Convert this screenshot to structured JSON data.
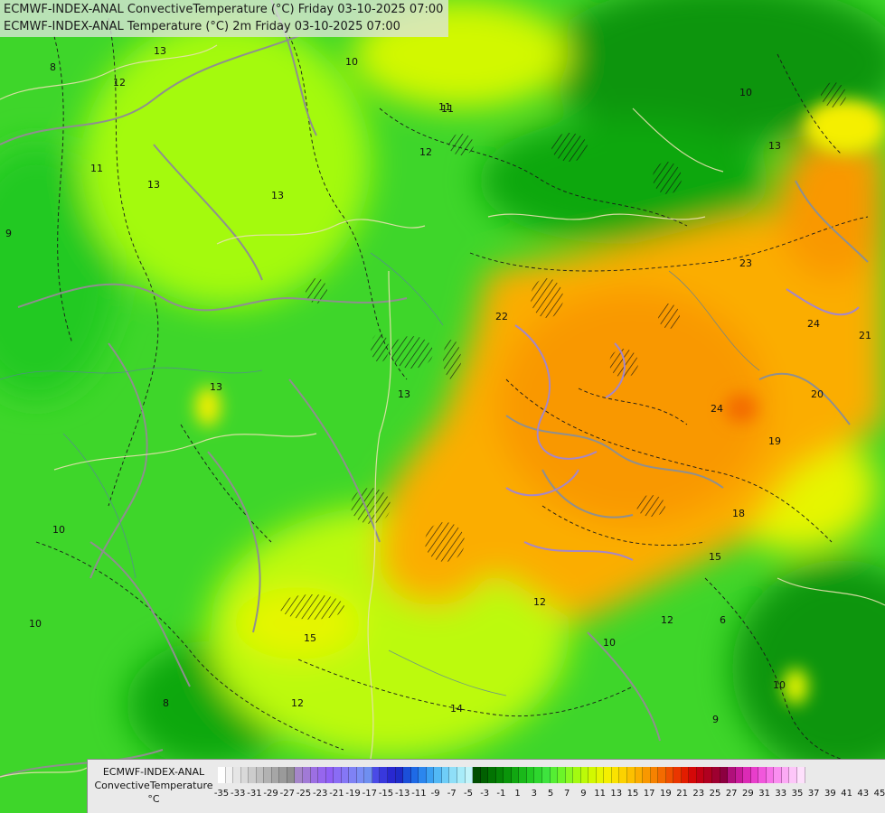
{
  "titles": {
    "line1": "ECMWF-INDEX-ANAL ConvectiveTemperature (°C) Friday 03-10-2025 07:00",
    "line2": "ECMWF-INDEX-ANAL Temperature (°C) 2m Friday 03-10-2025 07:00"
  },
  "legend": {
    "title_line1": "ECMWF-INDEX-ANAL",
    "title_line2": "ConvectiveTemperature",
    "title_line3": "°C",
    "tick_labels": [
      "-35",
      "-33",
      "-31",
      "-29",
      "-27",
      "-25",
      "-23",
      "-21",
      "-19",
      "-17",
      "-15",
      "-13",
      "-11",
      "-9",
      "-7",
      "-5",
      "-3",
      "-1",
      "1",
      "3",
      "5",
      "7",
      "9",
      "11",
      "13",
      "15",
      "17",
      "19",
      "21",
      "23",
      "25",
      "27",
      "29",
      "31",
      "33",
      "35",
      "37",
      "39",
      "41",
      "43",
      "45"
    ],
    "colors": [
      "#ffffff",
      "#f2f2f2",
      "#e6e6e6",
      "#d9d9d9",
      "#cccccc",
      "#bfbfbf",
      "#b2b2b2",
      "#a6a6a6",
      "#9a9a9a",
      "#8f8f8f",
      "#a586c9",
      "#a17ad6",
      "#9c6fe3",
      "#9666ee",
      "#8f5ff5",
      "#8a6cf5",
      "#8577f5",
      "#7f82f5",
      "#7a8df5",
      "#6f8ff0",
      "#4a4ae6",
      "#3838dd",
      "#2828d0",
      "#1e2bc8",
      "#1b4fd9",
      "#1e6ae6",
      "#2b86ee",
      "#3aa0f2",
      "#52b8f5",
      "#6fcdf7",
      "#8fdff8",
      "#a8ecf9",
      "#c2f4fa",
      "#014d01",
      "#016001",
      "#027302",
      "#058405",
      "#0a950a",
      "#11a711",
      "#1ab81a",
      "#22c922",
      "#2ed62e",
      "#3ee33e",
      "#55ee33",
      "#6cf428",
      "#8af820",
      "#a4fa10",
      "#bcfa08",
      "#d2f800",
      "#e6f500",
      "#f5ef00",
      "#fae200",
      "#fcd200",
      "#fcc000",
      "#fbad00",
      "#f99800",
      "#f68200",
      "#f36b00",
      "#ef5000",
      "#ea3600",
      "#e21d00",
      "#d40808",
      "#c20014",
      "#b00020",
      "#9e0030",
      "#8c0040",
      "#b0107a",
      "#c81a9a",
      "#db2ab5",
      "#e83ecb",
      "#f157dc",
      "#f772e8",
      "#fa8ef0",
      "#fcaaf5",
      "#fdc6f9",
      "#fee0fc"
    ]
  },
  "map": {
    "contour_labels": [
      "13",
      "11",
      "12",
      "8",
      "10",
      "13",
      "10",
      "11",
      "12",
      "13",
      "13",
      "10",
      "11",
      "13",
      "13",
      "9",
      "23",
      "22",
      "24",
      "24",
      "21",
      "20",
      "19",
      "18",
      "15",
      "12",
      "10",
      "6",
      "9",
      "14",
      "15",
      "12",
      "10",
      "8",
      "12",
      "10"
    ]
  }
}
